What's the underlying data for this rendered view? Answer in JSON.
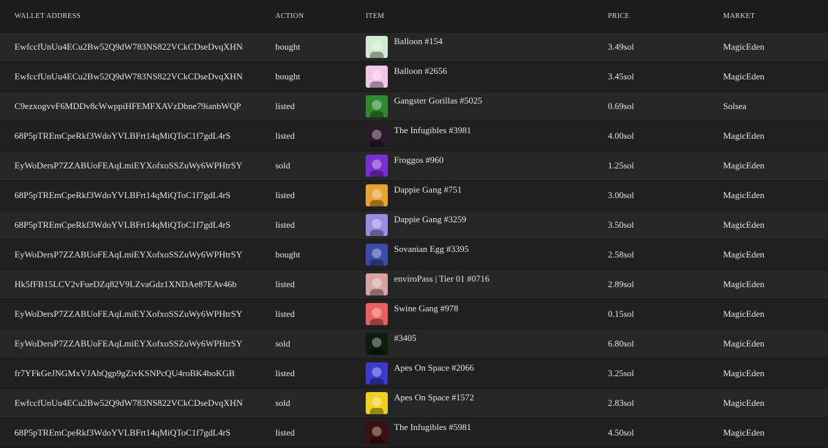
{
  "headers": {
    "wallet": "WALLET ADDRESS",
    "action": "ACTION",
    "item": "ITEM",
    "price": "PRICE",
    "market": "MARKET"
  },
  "rows": [
    {
      "wallet": "EwfccfUnUu4ECu2Bw52Q9dW783NS822VCkCDseDvqXHN",
      "action": "bought",
      "item": "Balloon #154",
      "price": "3.49sol",
      "market": "MagicEden",
      "thumb_color": "#cfeccf"
    },
    {
      "wallet": "EwfccfUnUu4ECu2Bw52Q9dW783NS822VCkCDseDvqXHN",
      "action": "bought",
      "item": "Balloon #2656",
      "price": "3.45sol",
      "market": "MagicEden",
      "thumb_color": "#f2c6e8"
    },
    {
      "wallet": "C9ezxogvvF6MDDv8cWwppiHFEMFXAVzDbne79ianbWQP",
      "action": "listed",
      "item": "Gangster Gorillas #5025",
      "price": "0.69sol",
      "market": "Solsea",
      "thumb_color": "#2f8a2f"
    },
    {
      "wallet": "68P5pTREmCpeRkf3WdoYVLBFrt14qMiQToC1f7gdL4rS",
      "action": "listed",
      "item": "The Infugibles #3981",
      "price": "4.00sol",
      "market": "MagicEden",
      "thumb_color": "#2a1a2a"
    },
    {
      "wallet": "EyWoDersP7ZZABUoFEAqLmiEYXofxoSSZuWy6WPHtrSY",
      "action": "sold",
      "item": "Froggos #960",
      "price": "1.25sol",
      "market": "MagicEden",
      "thumb_color": "#7a2fd0"
    },
    {
      "wallet": "68P5pTREmCpeRkf3WdoYVLBFrt14qMiQToC1f7gdL4rS",
      "action": "listed",
      "item": "Dappie Gang #751",
      "price": "3.00sol",
      "market": "MagicEden",
      "thumb_color": "#e8a232"
    },
    {
      "wallet": "68P5pTREmCpeRkf3WdoYVLBFrt14qMiQToC1f7gdL4rS",
      "action": "listed",
      "item": "Dappie Gang #3259",
      "price": "3.50sol",
      "market": "MagicEden",
      "thumb_color": "#9a8ae0"
    },
    {
      "wallet": "EyWoDersP7ZZABUoFEAqLmiEYXofxoSSZuWy6WPHtrSY",
      "action": "bought",
      "item": "Sovanian Egg #3395",
      "price": "2.58sol",
      "market": "MagicEden",
      "thumb_color": "#3c4aa8"
    },
    {
      "wallet": "Hk5fFB15LCV2vFueDZq82V9LZvaGdz1XNDAe87EAv46b",
      "action": "listed",
      "item": "enviroPass | Tier 01 #0716",
      "price": "2.89sol",
      "market": "MagicEden",
      "thumb_color": "#d9a3a3"
    },
    {
      "wallet": "EyWoDersP7ZZABUoFEAqLmiEYXofxoSSZuWy6WPHtrSY",
      "action": "listed",
      "item": "Swine Gang #978",
      "price": "0.15sol",
      "market": "MagicEden",
      "thumb_color": "#e86060"
    },
    {
      "wallet": "EyWoDersP7ZZABUoFEAqLmiEYXofxoSSZuWy6WPHtrSY",
      "action": "sold",
      "item": "#3405",
      "price": "6.80sol",
      "market": "MagicEden",
      "thumb_color": "#0f1a0f"
    },
    {
      "wallet": "fr7YFkGeJNGMxVJAhQgp9gZivKSNPcQU4roBK4boKGB",
      "action": "listed",
      "item": "Apes On Space #2066",
      "price": "3.25sol",
      "market": "MagicEden",
      "thumb_color": "#3a3ad0"
    },
    {
      "wallet": "EwfccfUnUu4ECu2Bw52Q9dW783NS822VCkCDseDvqXHN",
      "action": "sold",
      "item": "Apes On Space #1572",
      "price": "2.83sol",
      "market": "MagicEden",
      "thumb_color": "#f0d020"
    },
    {
      "wallet": "68P5pTREmCpeRkf3WdoYVLBFrt14qMiQToC1f7gdL4rS",
      "action": "listed",
      "item": "The Infugibles #5981",
      "price": "4.50sol",
      "market": "MagicEden",
      "thumb_color": "#3a1010"
    }
  ]
}
